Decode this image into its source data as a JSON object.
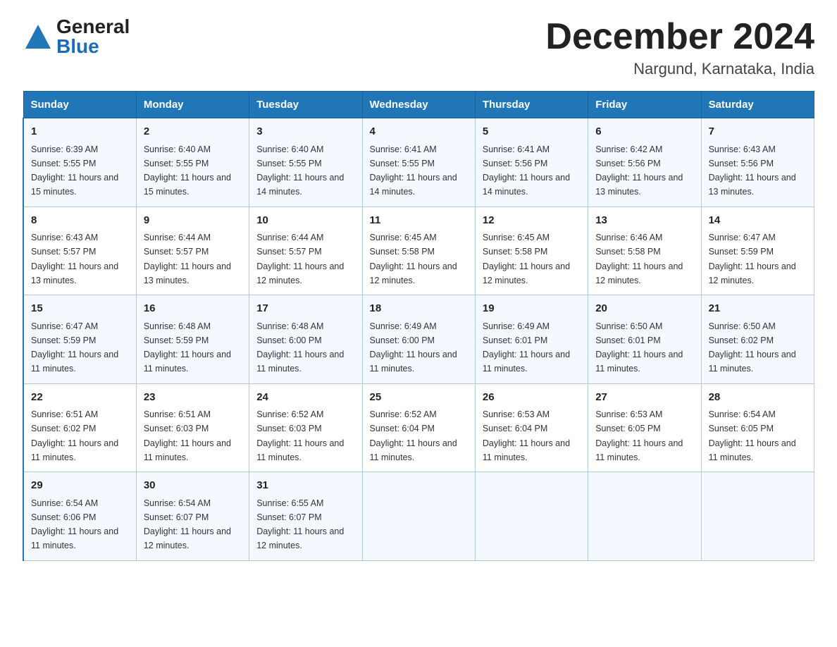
{
  "logo": {
    "general": "General",
    "blue": "Blue"
  },
  "header": {
    "month_year": "December 2024",
    "location": "Nargund, Karnataka, India"
  },
  "columns": [
    "Sunday",
    "Monday",
    "Tuesday",
    "Wednesday",
    "Thursday",
    "Friday",
    "Saturday"
  ],
  "weeks": [
    [
      {
        "day": "1",
        "sunrise": "Sunrise: 6:39 AM",
        "sunset": "Sunset: 5:55 PM",
        "daylight": "Daylight: 11 hours and 15 minutes."
      },
      {
        "day": "2",
        "sunrise": "Sunrise: 6:40 AM",
        "sunset": "Sunset: 5:55 PM",
        "daylight": "Daylight: 11 hours and 15 minutes."
      },
      {
        "day": "3",
        "sunrise": "Sunrise: 6:40 AM",
        "sunset": "Sunset: 5:55 PM",
        "daylight": "Daylight: 11 hours and 14 minutes."
      },
      {
        "day": "4",
        "sunrise": "Sunrise: 6:41 AM",
        "sunset": "Sunset: 5:55 PM",
        "daylight": "Daylight: 11 hours and 14 minutes."
      },
      {
        "day": "5",
        "sunrise": "Sunrise: 6:41 AM",
        "sunset": "Sunset: 5:56 PM",
        "daylight": "Daylight: 11 hours and 14 minutes."
      },
      {
        "day": "6",
        "sunrise": "Sunrise: 6:42 AM",
        "sunset": "Sunset: 5:56 PM",
        "daylight": "Daylight: 11 hours and 13 minutes."
      },
      {
        "day": "7",
        "sunrise": "Sunrise: 6:43 AM",
        "sunset": "Sunset: 5:56 PM",
        "daylight": "Daylight: 11 hours and 13 minutes."
      }
    ],
    [
      {
        "day": "8",
        "sunrise": "Sunrise: 6:43 AM",
        "sunset": "Sunset: 5:57 PM",
        "daylight": "Daylight: 11 hours and 13 minutes."
      },
      {
        "day": "9",
        "sunrise": "Sunrise: 6:44 AM",
        "sunset": "Sunset: 5:57 PM",
        "daylight": "Daylight: 11 hours and 13 minutes."
      },
      {
        "day": "10",
        "sunrise": "Sunrise: 6:44 AM",
        "sunset": "Sunset: 5:57 PM",
        "daylight": "Daylight: 11 hours and 12 minutes."
      },
      {
        "day": "11",
        "sunrise": "Sunrise: 6:45 AM",
        "sunset": "Sunset: 5:58 PM",
        "daylight": "Daylight: 11 hours and 12 minutes."
      },
      {
        "day": "12",
        "sunrise": "Sunrise: 6:45 AM",
        "sunset": "Sunset: 5:58 PM",
        "daylight": "Daylight: 11 hours and 12 minutes."
      },
      {
        "day": "13",
        "sunrise": "Sunrise: 6:46 AM",
        "sunset": "Sunset: 5:58 PM",
        "daylight": "Daylight: 11 hours and 12 minutes."
      },
      {
        "day": "14",
        "sunrise": "Sunrise: 6:47 AM",
        "sunset": "Sunset: 5:59 PM",
        "daylight": "Daylight: 11 hours and 12 minutes."
      }
    ],
    [
      {
        "day": "15",
        "sunrise": "Sunrise: 6:47 AM",
        "sunset": "Sunset: 5:59 PM",
        "daylight": "Daylight: 11 hours and 11 minutes."
      },
      {
        "day": "16",
        "sunrise": "Sunrise: 6:48 AM",
        "sunset": "Sunset: 5:59 PM",
        "daylight": "Daylight: 11 hours and 11 minutes."
      },
      {
        "day": "17",
        "sunrise": "Sunrise: 6:48 AM",
        "sunset": "Sunset: 6:00 PM",
        "daylight": "Daylight: 11 hours and 11 minutes."
      },
      {
        "day": "18",
        "sunrise": "Sunrise: 6:49 AM",
        "sunset": "Sunset: 6:00 PM",
        "daylight": "Daylight: 11 hours and 11 minutes."
      },
      {
        "day": "19",
        "sunrise": "Sunrise: 6:49 AM",
        "sunset": "Sunset: 6:01 PM",
        "daylight": "Daylight: 11 hours and 11 minutes."
      },
      {
        "day": "20",
        "sunrise": "Sunrise: 6:50 AM",
        "sunset": "Sunset: 6:01 PM",
        "daylight": "Daylight: 11 hours and 11 minutes."
      },
      {
        "day": "21",
        "sunrise": "Sunrise: 6:50 AM",
        "sunset": "Sunset: 6:02 PM",
        "daylight": "Daylight: 11 hours and 11 minutes."
      }
    ],
    [
      {
        "day": "22",
        "sunrise": "Sunrise: 6:51 AM",
        "sunset": "Sunset: 6:02 PM",
        "daylight": "Daylight: 11 hours and 11 minutes."
      },
      {
        "day": "23",
        "sunrise": "Sunrise: 6:51 AM",
        "sunset": "Sunset: 6:03 PM",
        "daylight": "Daylight: 11 hours and 11 minutes."
      },
      {
        "day": "24",
        "sunrise": "Sunrise: 6:52 AM",
        "sunset": "Sunset: 6:03 PM",
        "daylight": "Daylight: 11 hours and 11 minutes."
      },
      {
        "day": "25",
        "sunrise": "Sunrise: 6:52 AM",
        "sunset": "Sunset: 6:04 PM",
        "daylight": "Daylight: 11 hours and 11 minutes."
      },
      {
        "day": "26",
        "sunrise": "Sunrise: 6:53 AM",
        "sunset": "Sunset: 6:04 PM",
        "daylight": "Daylight: 11 hours and 11 minutes."
      },
      {
        "day": "27",
        "sunrise": "Sunrise: 6:53 AM",
        "sunset": "Sunset: 6:05 PM",
        "daylight": "Daylight: 11 hours and 11 minutes."
      },
      {
        "day": "28",
        "sunrise": "Sunrise: 6:54 AM",
        "sunset": "Sunset: 6:05 PM",
        "daylight": "Daylight: 11 hours and 11 minutes."
      }
    ],
    [
      {
        "day": "29",
        "sunrise": "Sunrise: 6:54 AM",
        "sunset": "Sunset: 6:06 PM",
        "daylight": "Daylight: 11 hours and 11 minutes."
      },
      {
        "day": "30",
        "sunrise": "Sunrise: 6:54 AM",
        "sunset": "Sunset: 6:07 PM",
        "daylight": "Daylight: 11 hours and 12 minutes."
      },
      {
        "day": "31",
        "sunrise": "Sunrise: 6:55 AM",
        "sunset": "Sunset: 6:07 PM",
        "daylight": "Daylight: 11 hours and 12 minutes."
      },
      null,
      null,
      null,
      null
    ]
  ]
}
